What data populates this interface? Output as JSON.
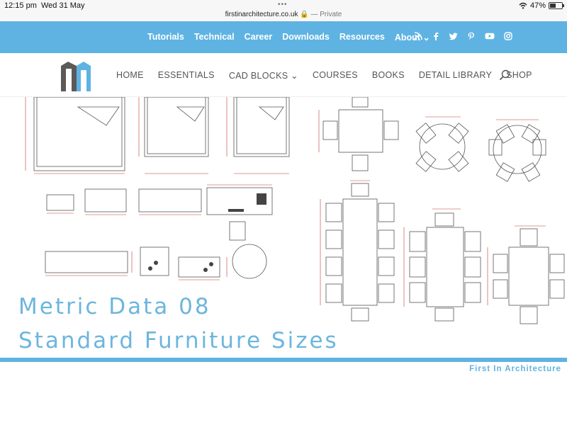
{
  "status_bar": {
    "time": "12:15 pm",
    "date": "Wed 31 May",
    "dots": "•••",
    "url": "firstinarchitecture.co.uk",
    "private": "— Private",
    "battery": "47%",
    "battery_level": 0.47
  },
  "top_nav": {
    "items": [
      "Tutorials",
      "Technical",
      "Career",
      "Downloads",
      "Resources",
      "About ⌄"
    ]
  },
  "main_nav": {
    "items": [
      "HOME",
      "ESSENTIALS",
      "CAD BLOCKS ⌄",
      "COURSES",
      "BOOKS",
      "DETAIL LIBRARY",
      "SHOP"
    ]
  },
  "hero": {
    "title_line1": "Metric Data 08",
    "title_line2": "Standard Furniture Sizes",
    "brand": "First In Architecture"
  },
  "colors": {
    "brand_blue": "#5fb3e2",
    "title_blue": "#6cb6de"
  },
  "icons": [
    "wifi-icon",
    "battery-icon",
    "lock-icon",
    "rss-icon",
    "facebook-icon",
    "twitter-icon",
    "pinterest-icon",
    "youtube-icon",
    "instagram-icon",
    "search-icon"
  ]
}
